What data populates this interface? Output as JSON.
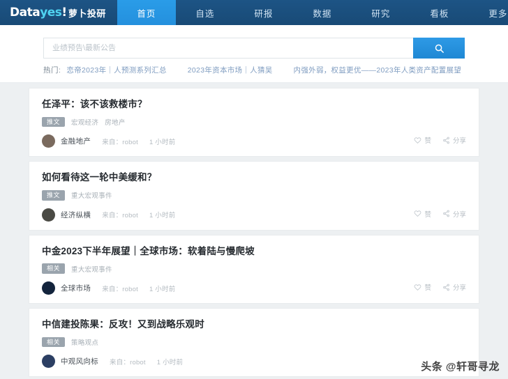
{
  "nav": {
    "logo": {
      "part_data": "Data",
      "part_yes": "yes",
      "part_bang": "!",
      "part_cn": "萝卜投研"
    },
    "items": [
      {
        "label": "首页",
        "active": true
      },
      {
        "label": "自选",
        "active": false
      },
      {
        "label": "研报",
        "active": false
      },
      {
        "label": "数据",
        "active": false
      },
      {
        "label": "研究",
        "active": false
      },
      {
        "label": "看板",
        "active": false
      },
      {
        "label": "更多",
        "active": false
      }
    ]
  },
  "search": {
    "placeholder": "业绩预告\\最新公告",
    "value": "",
    "button_icon": "search-icon",
    "hot_label": "热门:",
    "hot_links": [
      "恋帝2023年｜人预测系列汇总",
      "2023年资本市场｜人猜吴",
      "内强外弱，权益更优——2023年人类资产配置展望"
    ]
  },
  "feed": {
    "cards": [
      {
        "title": "任泽平：该不该救楼市？",
        "badge": "推文",
        "tags": [
          "宏观经济",
          "房地产"
        ],
        "author": "金融地产",
        "source": "来自：robot",
        "time": "1 小时前",
        "like_label": "赞",
        "share_label": "分享",
        "avatar_class": "a1"
      },
      {
        "title": "如何看待这一轮中美缓和？",
        "badge": "推文",
        "tags": [
          "重大宏观事件"
        ],
        "author": "经济纵横",
        "source": "来自：robot",
        "time": "1 小时前",
        "like_label": "赞",
        "share_label": "分享",
        "avatar_class": "a2"
      },
      {
        "title": "中金2023下半年展望｜全球市场：软着陆与慢爬坡",
        "badge": "相关",
        "tags": [
          "重大宏观事件"
        ],
        "author": "全球市场",
        "source": "来自：robot",
        "time": "1 小时前",
        "like_label": "赞",
        "share_label": "分享",
        "avatar_class": "a3"
      },
      {
        "title": "中信建投陈果：反攻！又到战略乐观时",
        "badge": "相关",
        "tags": [
          "策略观点"
        ],
        "author": "中观风向标",
        "source": "来自：robot",
        "time": "1 小时前",
        "like_label": "",
        "share_label": "",
        "avatar_class": "a4"
      }
    ]
  },
  "watermark": {
    "text": "头条 @轩哥寻龙"
  },
  "colors": {
    "nav_bg": "#1b4f7e",
    "nav_active": "#2594e0",
    "accent": "#2490dd",
    "logo_cyan": "#4fd2f0",
    "badge_gray": "#9aa4ad"
  }
}
